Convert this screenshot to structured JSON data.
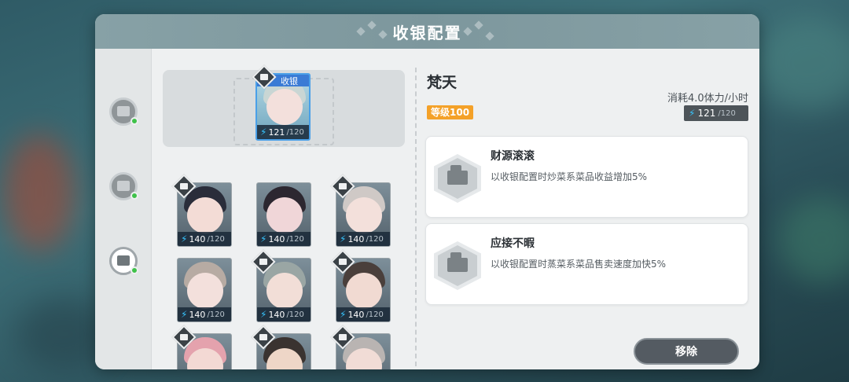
{
  "dialog": {
    "title": "收银配置"
  },
  "sidebar": {
    "tabs": [
      {
        "name": "tab-1"
      },
      {
        "name": "tab-2"
      },
      {
        "name": "tab-cashier",
        "active": true
      }
    ]
  },
  "selected": {
    "slot_label": "收银",
    "energy": "121",
    "energy_max": "/120"
  },
  "roster": [
    {
      "energy": "140",
      "max": "/120",
      "badge": true,
      "hair": "#2a2d3a",
      "face": "#f3dcd6"
    },
    {
      "energy": "140",
      "max": "/120",
      "badge": false,
      "hair": "#2c2730",
      "face": "#f0d6d8"
    },
    {
      "energy": "140",
      "max": "/120",
      "badge": true,
      "hair": "#cfc9c6",
      "face": "#f3e0db"
    },
    {
      "energy": "140",
      "max": "/120",
      "badge": false,
      "hair": "#b7aba3",
      "face": "#f3e0dc"
    },
    {
      "energy": "140",
      "max": "/120",
      "badge": true,
      "hair": "#9aa6a4",
      "face": "#f2ded7"
    },
    {
      "energy": "140",
      "max": "/120",
      "badge": true,
      "hair": "#4a3f3b",
      "face": "#f1dad2"
    },
    {
      "energy": "",
      "max": "",
      "badge": true,
      "hair": "#e4a2ad",
      "face": "#f3d9d4"
    },
    {
      "energy": "",
      "max": "",
      "badge": true,
      "hair": "#3a3330",
      "face": "#eed6c7"
    },
    {
      "energy": "",
      "max": "",
      "badge": true,
      "hair": "#b9b4b2",
      "face": "#f1dcd6"
    }
  ],
  "detail": {
    "name": "梵天",
    "level": "等级100",
    "cost": "消耗4.0体力/小时",
    "energy": "121",
    "energy_max": "/120",
    "skills": [
      {
        "title": "财源滚滚",
        "desc": "以收银配置时炒菜系菜品收益增加5%"
      },
      {
        "title": "应接不暇",
        "desc": "以收银配置时蒸菜系菜品售卖速度加快5%"
      }
    ],
    "remove_label": "移除"
  },
  "colors": {
    "accent": "#f4a128",
    "energy": "#37c6ff",
    "header": "#87a1a6"
  },
  "icons": {
    "bolt": "⚡"
  }
}
